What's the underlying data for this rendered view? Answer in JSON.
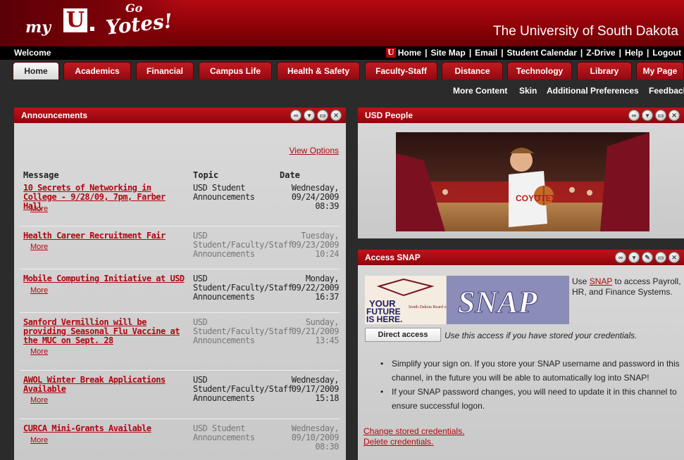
{
  "header": {
    "logo_my": "my",
    "logo_u": "U",
    "logo_go": "Go",
    "logo_yotes": "Yotes!",
    "university": "The University of South Dakota"
  },
  "topbar": {
    "welcome": "Welcome",
    "links": [
      "Home",
      "Site Map",
      "Email",
      "Student Calendar",
      "Z-Drive",
      "Help",
      "Logout"
    ]
  },
  "tabs": [
    "Home",
    "Academics",
    "Financial",
    "Campus Life",
    "Health & Safety",
    "Faculty-Staff",
    "Distance",
    "Technology",
    "Library",
    "My Page"
  ],
  "subnav": [
    "More Content",
    "Skin",
    "Additional Preferences",
    "Feedback"
  ],
  "announcements": {
    "title": "Announcements",
    "view_options": "View Options",
    "headers": {
      "message": "Message",
      "topic": "Topic",
      "date": "Date"
    },
    "more_label": "More",
    "items": [
      {
        "message": "10 Secrets of Networking in College - 9/28/09, 7pm, Farber Hall",
        "topic": "USD Student Announcements",
        "day": "Wednesday,",
        "date": "09/24/2009",
        "time": "08:39",
        "new": true
      },
      {
        "message": "Health Career Recruitment Fair",
        "topic": "USD Student/Faculty/Staff Announcements",
        "day": "Tuesday,",
        "date": "09/23/2009",
        "time": "10:24",
        "new": false
      },
      {
        "message": "Mobile Computing Initiative at USD",
        "topic": "USD Student/Faculty/Staff Announcements",
        "day": "Monday,",
        "date": "09/22/2009",
        "time": "16:37",
        "new": true
      },
      {
        "message": "Sanford Vermillion will be providing Seasonal Flu Vaccine at the MUC on Sept. 28",
        "topic": "USD Student/Faculty/Staff Announcements",
        "day": "Sunday,",
        "date": "09/21/2009",
        "time": "13:45",
        "new": false
      },
      {
        "message": "AWOL Winter Break Applications Available",
        "topic": "USD Student/Faculty/Staff Announcements",
        "day": "Wednesday,",
        "date": "09/17/2009",
        "time": "15:18",
        "new": true
      },
      {
        "message": "CURCA Mini-Grants Available",
        "topic": "USD Student Announcements",
        "day": "Wednesday,",
        "date": "09/10/2009",
        "time": "08:30",
        "new": false
      }
    ]
  },
  "people": {
    "title": "USD People"
  },
  "snap": {
    "title": "Access SNAP",
    "logo_your": "YOUR",
    "logo_future": "FUTURE",
    "logo_is_here": "IS HERE.",
    "logo_board": "South Dakota Board of Regents",
    "logo_snap": "SNAP",
    "use_prefix": "Use ",
    "snap_link": "SNAP",
    "use_suffix": " to access Payroll, HR, and Finance Systems.",
    "direct_button": "Direct access",
    "direct_note": "Use this access if you have stored your credentials.",
    "bullets": [
      "Simplify your sign on. If you store your SNAP username and password in this channel, in the future you will be able to automatically log into SNAP!",
      "If your SNAP password changes, you will need to update it in this channel to ensure successful logon."
    ],
    "change_link": "Change stored credentials.",
    "delete_link": "Delete credentials."
  },
  "colors": {
    "brand_red": "#9e0a10",
    "link_red": "#b10610",
    "panel_grey": "#d2d2d2"
  }
}
